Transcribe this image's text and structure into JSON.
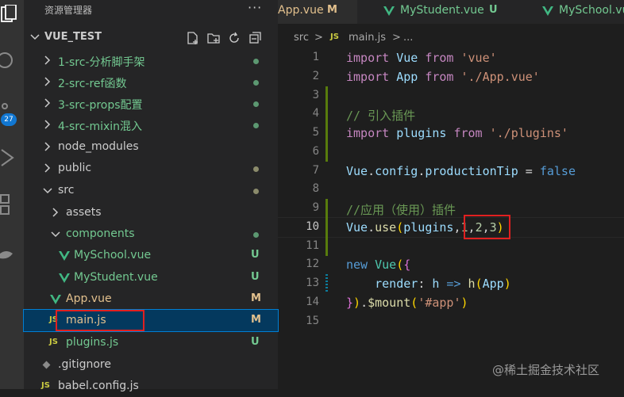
{
  "sidebar": {
    "title": "资源管理器",
    "more": "···",
    "project": "VUE_TEST",
    "items": [
      {
        "label": "1-src-分析脚手架",
        "kind": "folder"
      },
      {
        "label": "2-src-ref函数",
        "kind": "folder"
      },
      {
        "label": "3-src-props配置",
        "kind": "folder"
      },
      {
        "label": "4-src-mixin混入",
        "kind": "folder"
      },
      {
        "label": "node_modules",
        "kind": "folder"
      },
      {
        "label": "public",
        "kind": "folder"
      },
      {
        "label": "src",
        "kind": "folder-open"
      },
      {
        "label": "assets",
        "kind": "folder"
      },
      {
        "label": "components",
        "kind": "folder-open"
      },
      {
        "label": "MySchool.vue",
        "kind": "vue",
        "status": "U"
      },
      {
        "label": "MyStudent.vue",
        "kind": "vue",
        "status": "U"
      },
      {
        "label": "App.vue",
        "kind": "vue",
        "status": "M"
      },
      {
        "label": "main.js",
        "kind": "js",
        "status": "M",
        "selected": true
      },
      {
        "label": "plugins.js",
        "kind": "js",
        "status": "U"
      },
      {
        "label": ".gitignore",
        "kind": "other"
      },
      {
        "label": "babel.config.js",
        "kind": "js"
      }
    ]
  },
  "activity": {
    "badge": "27"
  },
  "tabs": [
    {
      "label": "App.vue",
      "status": "M"
    },
    {
      "label": "MyStudent.vue",
      "status": "U"
    },
    {
      "label": "MySchool.vue",
      "status": ""
    }
  ],
  "breadcrumb": {
    "folder": "src",
    "sep": ">",
    "file_icon": "JS",
    "file": "main.js",
    "sep2": ">",
    "more": "..."
  },
  "icons": {
    "js": "JS"
  },
  "editor": {
    "lines": [
      {
        "n": "1"
      },
      {
        "n": "2"
      },
      {
        "n": "3"
      },
      {
        "n": "4"
      },
      {
        "n": "5"
      },
      {
        "n": "6"
      },
      {
        "n": "7"
      },
      {
        "n": "8"
      },
      {
        "n": "9"
      },
      {
        "n": "10"
      },
      {
        "n": "11"
      },
      {
        "n": "12"
      },
      {
        "n": "13"
      },
      {
        "n": "14"
      },
      {
        "n": "15"
      }
    ],
    "tokens": {
      "import": "import",
      "from": "from",
      "vue_mod": "'vue'",
      "vue": "Vue",
      "app": "App",
      "app_mod": "'./App.vue'",
      "comment1": "// 引入插件",
      "plugins": "plugins",
      "plugins_mod": "'./plugins'",
      "config": "config",
      "productionTip": "productionTip",
      "false": "false",
      "comment2": "//应用（使用）插件",
      "use": "use",
      "n1": "1",
      "n2": "2",
      "n3": "3",
      "new": "new",
      "render": "render",
      "h": "h",
      "mount": "$mount",
      "app_sel": "'#app'"
    }
  },
  "watermark": "@稀土掘金技术社区",
  "colors": {
    "selected_bg": "#04395e",
    "highlight_box": "#e02020",
    "vue_green": "#41b883",
    "js_yellow": "#cbcb41",
    "modified": "#e2c08d",
    "untracked": "#73c991"
  }
}
